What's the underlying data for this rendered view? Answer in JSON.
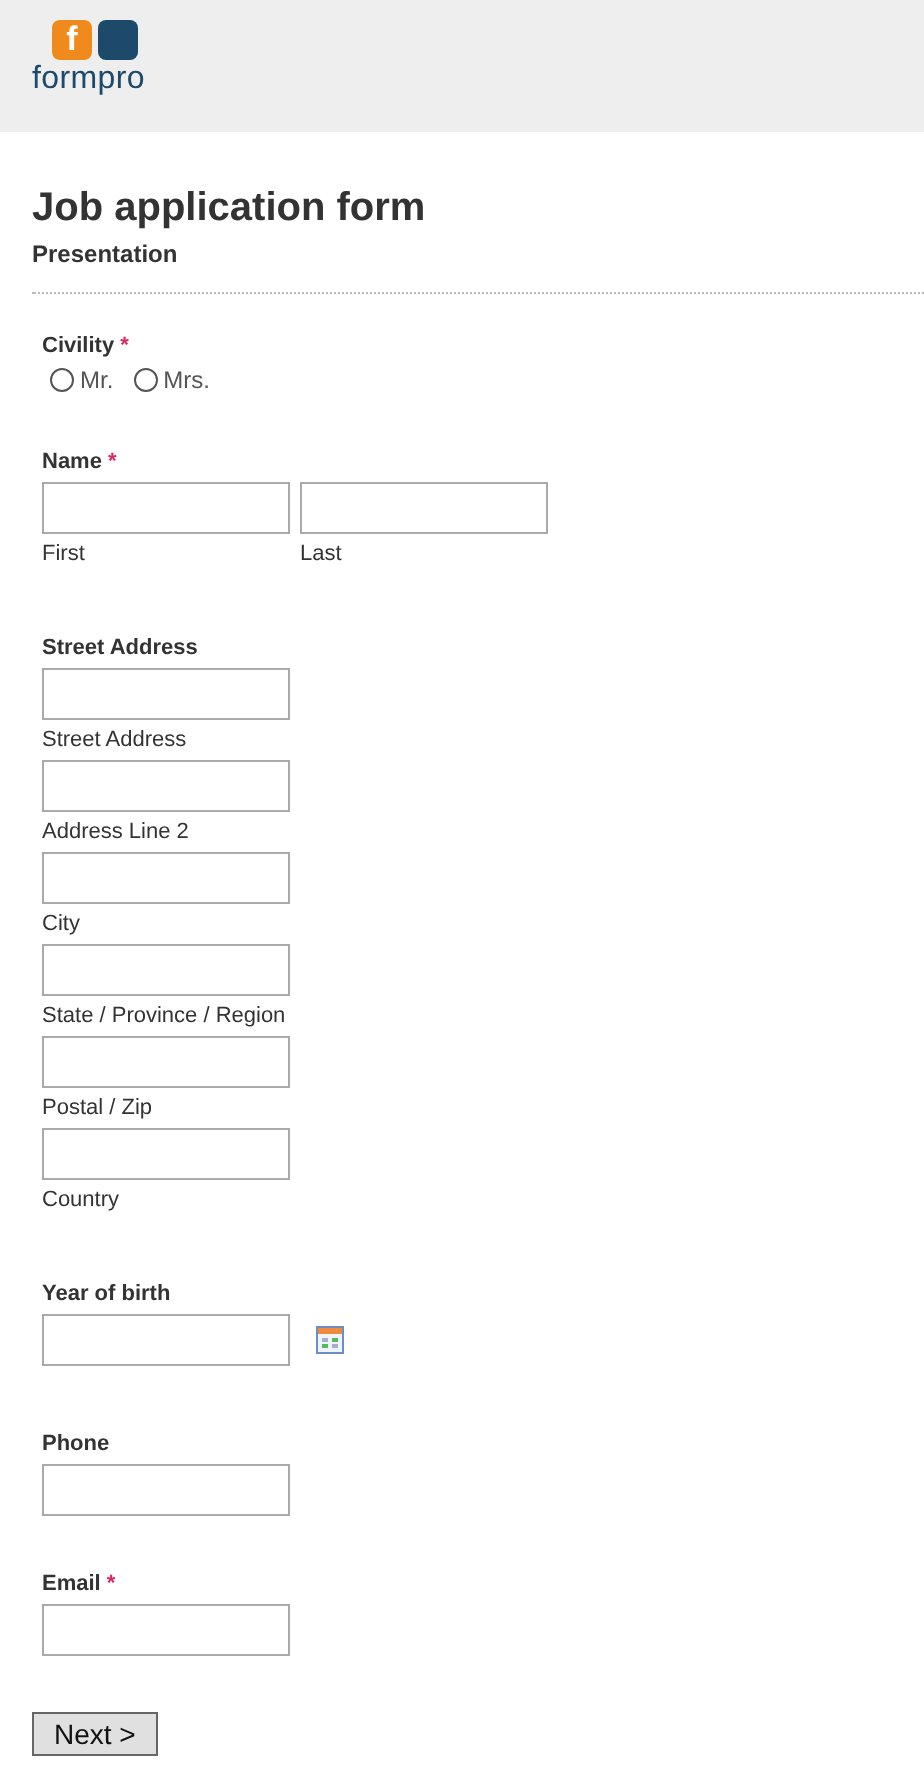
{
  "logo": {
    "mark": "f",
    "name": "formpro"
  },
  "form": {
    "title": "Job application form",
    "section": "Presentation"
  },
  "fields": [
    {
      "kind": "radio",
      "label": "Civility",
      "required_mark": "*",
      "options": [
        {
          "label": "Mr.",
          "selected": false
        },
        {
          "label": "Mrs.",
          "selected": false
        }
      ]
    },
    {
      "kind": "name",
      "label": "Name",
      "required_mark": "*",
      "parts": [
        "First",
        "Last"
      ]
    },
    {
      "kind": "address",
      "label": "Street Address",
      "parts": [
        "Street Address",
        "Address Line 2",
        "City",
        "State / Province / Region",
        "Postal / Zip",
        "Country"
      ]
    },
    {
      "kind": "date",
      "label": "Year of birth"
    },
    {
      "kind": "text",
      "label": "Phone"
    },
    {
      "kind": "text",
      "label": "Email",
      "required_mark": "*"
    }
  ],
  "next_button": "Next >"
}
